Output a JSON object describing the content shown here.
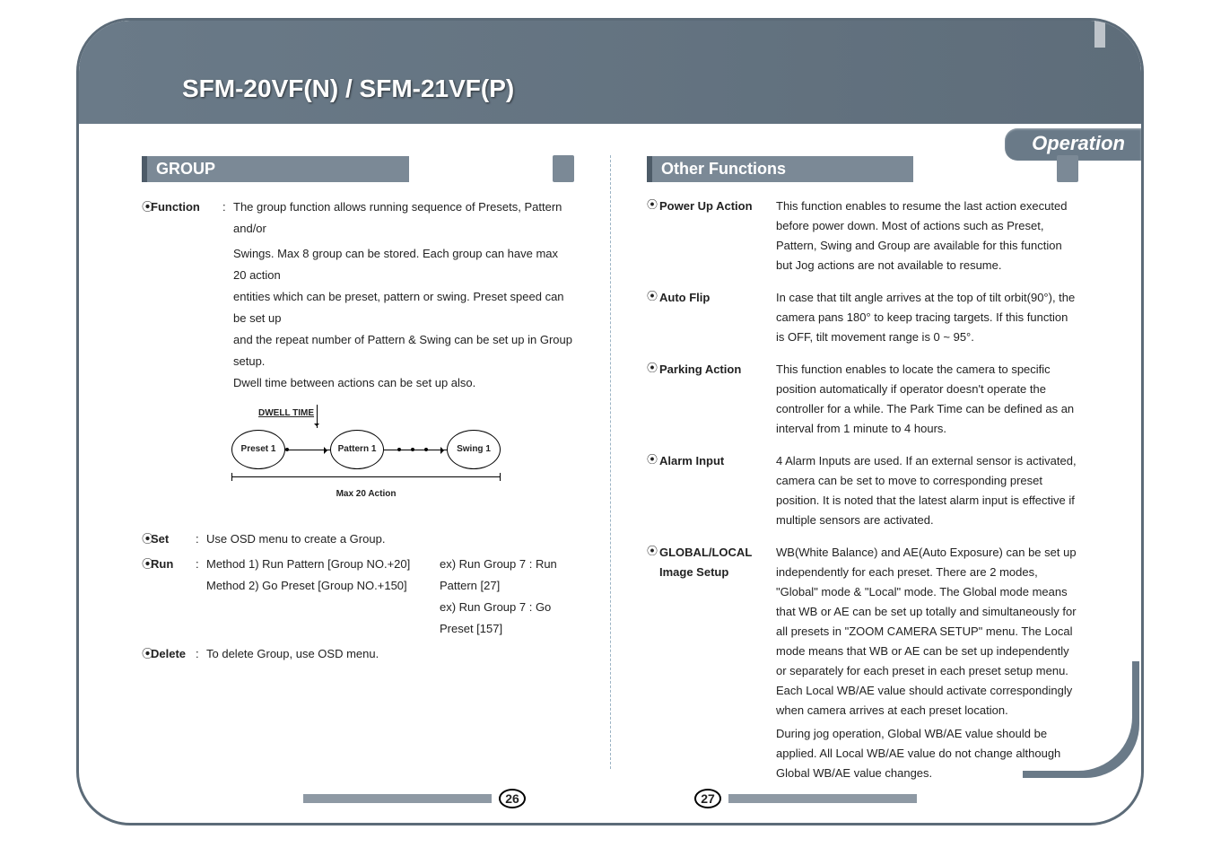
{
  "header": {
    "title": "SFM-20VF(N) / SFM-21VF(P)"
  },
  "section_tab": "Operation",
  "left": {
    "heading": "GROUP",
    "function_label": "Function",
    "function_text_l1": "The group function allows running sequence of Presets, Pattern and/or",
    "function_text_l2": "Swings. Max 8 group can be stored. Each group can have max 20 action",
    "function_text_l3": "entities which can be preset, pattern or swing. Preset speed can be set up",
    "function_text_l4": "and the repeat number of Pattern & Swing can be set up in Group setup.",
    "function_text_l5": "Dwell time between actions can be set up also.",
    "diagram": {
      "dwell": "DWELL TIME",
      "node1": "Preset  1",
      "node2": "Pattern  1",
      "node3": "Swing  1",
      "max": "Max 20 Action"
    },
    "set_label": "Set",
    "set_text": "Use OSD menu to create a Group.",
    "run_label": "Run",
    "run_method1": "Method 1) Run Pattern [Group NO.+20]",
    "run_ex1": "ex) Run Group 7 : Run Pattern [27]",
    "run_method2": "Method 2) Go Preset [Group NO.+150]",
    "run_ex2": "ex) Run Group 7 : Go Preset [157]",
    "delete_label": "Delete",
    "delete_text": "To delete Group, use OSD menu."
  },
  "right": {
    "heading": "Other Functions",
    "items": [
      {
        "label": "Power Up Action",
        "desc": "This function enables to resume the last action executed before power down. Most of actions such as Preset, Pattern, Swing and Group are available for this function but Jog actions are not  available to resume."
      },
      {
        "label": "Auto Flip",
        "desc": "In case that tilt angle arrives at the top of tilt orbit(90°), the camera pans 180° to keep tracing targets. If this function is OFF, tilt movement range is 0 ~ 95°."
      },
      {
        "label": "Parking Action",
        "desc": "This function enables to locate the camera to specific position automatically if operator doesn't operate the controller for a while.  The Park Time can be defined as an interval from 1 minute to 4 hours."
      },
      {
        "label": "Alarm Input",
        "desc": "4 Alarm Inputs are used. If an external sensor is activated, camera can be set to move to corresponding preset position. It is noted that the latest alarm input is effective if multiple sensors are activated."
      },
      {
        "label": "GLOBAL/LOCAL Image Setup",
        "desc": "WB(White Balance) and AE(Auto Exposure) can be set up independently for each preset. There are 2 modes, \"Global\" mode & \"Local\" mode. The Global mode means that WB or AE can be set up totally and simultaneously for all presets in \"ZOOM CAMERA SETUP\" menu. The Local mode means that WB or AE can be set up independently or separately for each preset in each preset setup menu. Each Local WB/AE value should activate correspondingly when camera arrives at each preset location.",
        "desc2": "During jog operation, Global WB/AE value should be applied. All Local WB/AE value do not change although Global WB/AE value changes."
      }
    ]
  },
  "page_numbers": {
    "left": "26",
    "right": "27"
  },
  "glyph": {
    "dot": "⦿"
  }
}
